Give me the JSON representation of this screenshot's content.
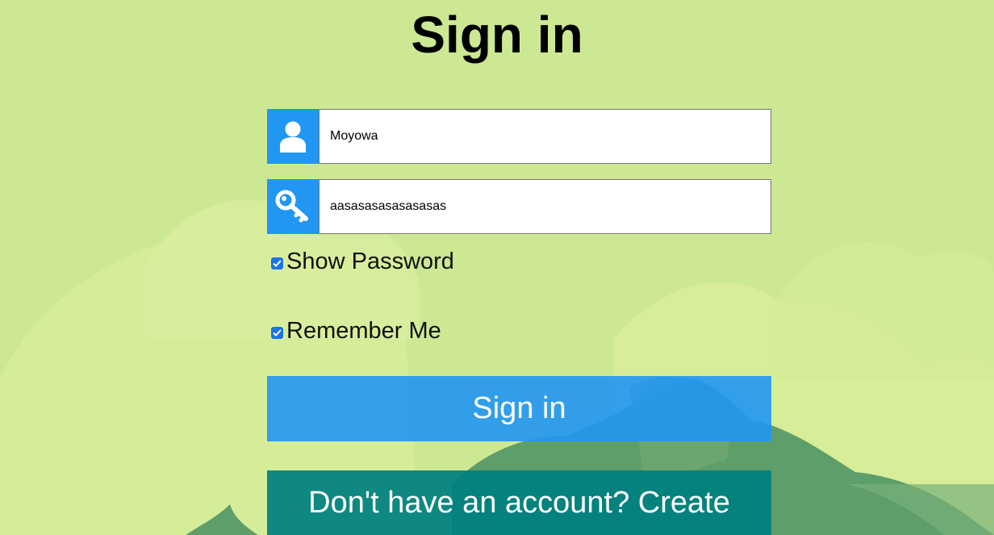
{
  "page": {
    "title": "Sign in"
  },
  "form": {
    "username": {
      "icon": "user-icon",
      "value": "Moyowa"
    },
    "password": {
      "icon": "key-icon",
      "value": "aasasasasasasasas"
    },
    "show_password": {
      "label": "Show Password",
      "checked": true
    },
    "remember_me": {
      "label": "Remember Me",
      "checked": true
    },
    "submit_label": "Sign in",
    "create_account_label": "Don't have an account? Create"
  },
  "colors": {
    "accent": "#2196f3",
    "create_button": "#008080",
    "background": "#cde893"
  }
}
